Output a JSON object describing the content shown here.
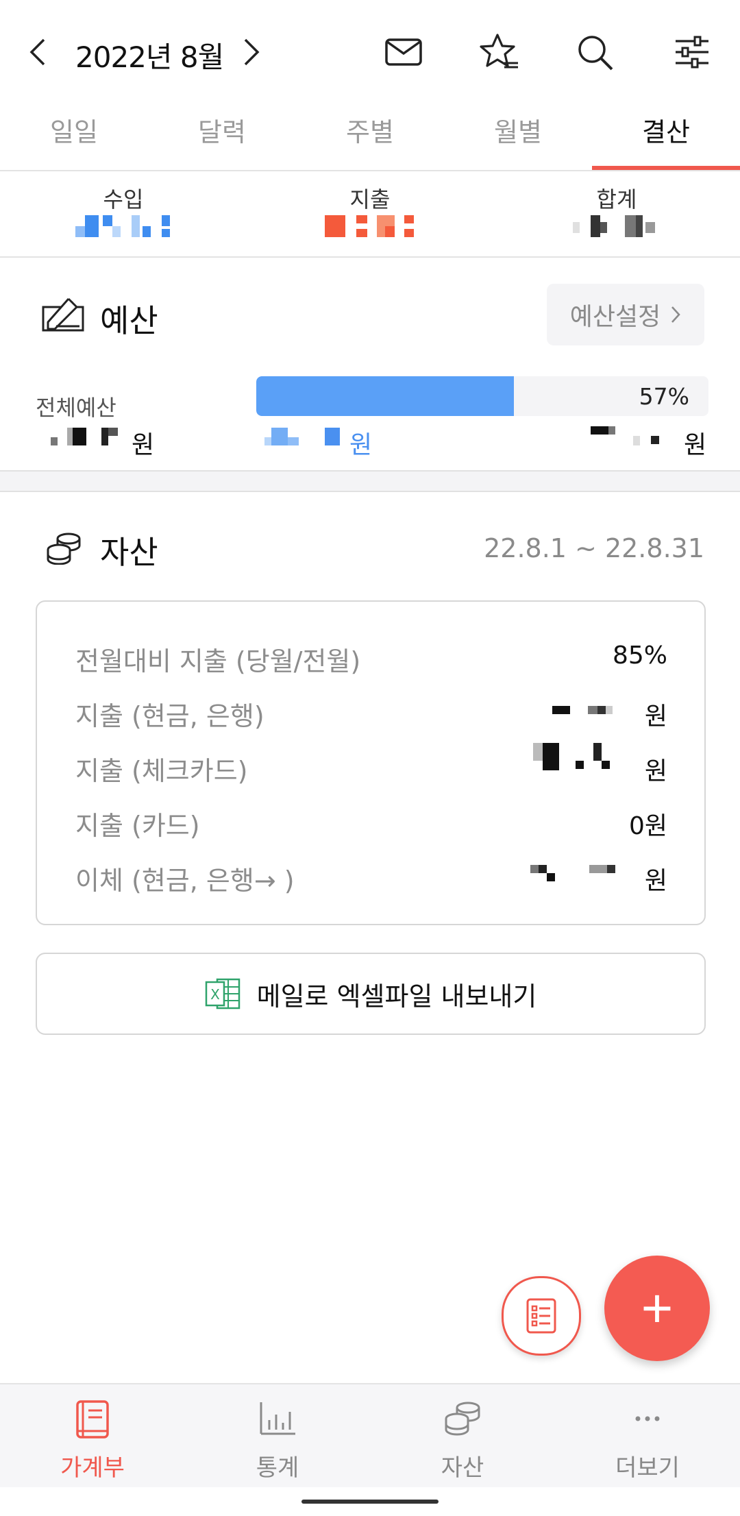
{
  "header": {
    "month": "2022년 8월",
    "icons": [
      "chevron-left-icon",
      "chevron-right-icon",
      "mail-icon",
      "star-list-icon",
      "search-icon",
      "filter-sliders-icon"
    ]
  },
  "tabs": [
    {
      "label": "일일",
      "active": false
    },
    {
      "label": "달력",
      "active": false
    },
    {
      "label": "주별",
      "active": false
    },
    {
      "label": "월별",
      "active": false
    },
    {
      "label": "결산",
      "active": true
    }
  ],
  "summary": {
    "income_label": "수입",
    "expense_label": "지출",
    "total_label": "합계",
    "colors": {
      "income": "#4a90f0",
      "expense": "#f0584d",
      "total": "#333333"
    }
  },
  "budget": {
    "title": "예산",
    "settings_button": "예산설정",
    "total_label": "전체예산",
    "percent": "57%",
    "fill_fraction": 0.57,
    "unit_won": "원",
    "bar_color": "#5aa0f7"
  },
  "assets": {
    "title": "자산",
    "period": "22.8.1  ~  22.8.31",
    "rows": [
      {
        "label": "전월대비 지출 (당월/전월)",
        "value": "85%"
      },
      {
        "label": "지출 (현금, 은행)",
        "value": "원"
      },
      {
        "label": "지출 (체크카드)",
        "value": "원"
      },
      {
        "label": "지출 (카드)",
        "value": "0원"
      },
      {
        "label": "이체  (현금, 은행→ )",
        "value": "원"
      }
    ],
    "export_button": "메일로 엑셀파일 내보내기"
  },
  "fab": {
    "add_symbol": "+"
  },
  "bottom_nav": [
    {
      "label": "가계부",
      "icon": "ledger-book-icon",
      "active": true
    },
    {
      "label": "통계",
      "icon": "bar-stats-icon",
      "active": false
    },
    {
      "label": "자산",
      "icon": "coins-icon",
      "active": false
    },
    {
      "label": "더보기",
      "icon": "more-dots-icon",
      "active": false
    }
  ],
  "accent_color": "#f0584d"
}
